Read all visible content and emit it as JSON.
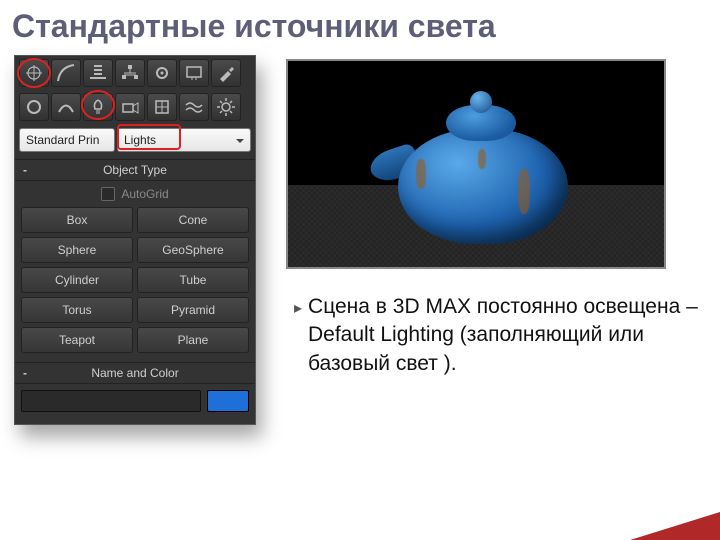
{
  "slide": {
    "title": "Стандартные источники света",
    "body": "Сцена в 3D MAX постоянно освещена – Default Lighting (заполняющий или базовый свет )."
  },
  "panel": {
    "toolbar1": [
      {
        "name": "geometry-icon"
      },
      {
        "name": "shapes-icon"
      },
      {
        "name": "lights-icon-top"
      },
      {
        "name": "hierarchy-icon"
      },
      {
        "name": "motion-icon"
      },
      {
        "name": "display-icon"
      },
      {
        "name": "utilities-icon"
      }
    ],
    "toolbar2": [
      {
        "name": "circle-tool-icon"
      },
      {
        "name": "path-tool-icon"
      },
      {
        "name": "light-tool-icon"
      },
      {
        "name": "camera-tool-icon"
      },
      {
        "name": "helper-tool-icon"
      },
      {
        "name": "spacewarp-tool-icon"
      },
      {
        "name": "systems-tool-icon"
      }
    ],
    "dropdown1": "Standard Prin",
    "dropdown2": "Lights",
    "sections": {
      "objectType": "Object Type",
      "autoGrid": "AutoGrid",
      "nameAndColor": "Name and Color"
    },
    "objects": [
      "Box",
      "Cone",
      "Sphere",
      "GeoSphere",
      "Cylinder",
      "Tube",
      "Torus",
      "Pyramid",
      "Teapot",
      "Plane"
    ],
    "swatch": "#1e6fd8"
  },
  "render": {
    "alt": "Blue teapot 3D render with default lighting"
  }
}
